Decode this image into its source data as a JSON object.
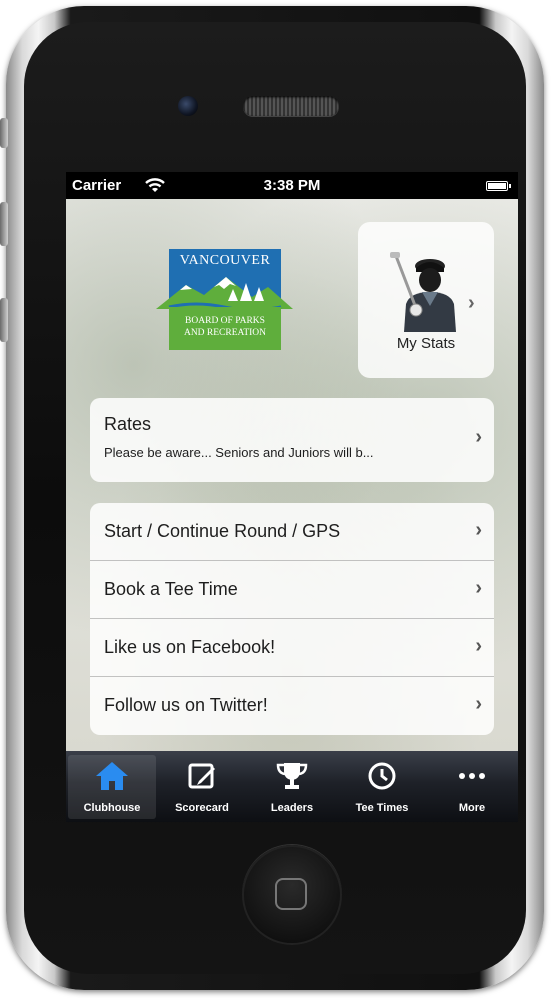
{
  "status_bar": {
    "carrier": "Carrier",
    "time": "3:38 PM"
  },
  "logo": {
    "title": "VANCOUVER",
    "line1": "BOARD OF PARKS",
    "line2": "AND RECREATION"
  },
  "stats": {
    "label": "My Stats",
    "icon": "golfer-icon"
  },
  "rates": {
    "title": "Rates",
    "message": "Please be aware... Seniors and Juniors will b..."
  },
  "menu": {
    "items": [
      {
        "label": "Start / Continue Round / GPS"
      },
      {
        "label": "Book a Tee Time"
      },
      {
        "label": "Like us on Facebook!"
      },
      {
        "label": "Follow us on Twitter!"
      }
    ]
  },
  "tabs": {
    "items": [
      {
        "label": "Clubhouse",
        "icon": "house-icon",
        "active": true
      },
      {
        "label": "Scorecard",
        "icon": "pencil-square-icon",
        "active": false
      },
      {
        "label": "Leaders",
        "icon": "trophy-icon",
        "active": false
      },
      {
        "label": "Tee Times",
        "icon": "clock-icon",
        "active": false
      },
      {
        "label": "More",
        "icon": "ellipsis-icon",
        "active": false
      }
    ]
  },
  "colors": {
    "active_tab": "#2a8cf0",
    "logo_blue": "#1f6fb2",
    "logo_green": "#5fae3c"
  }
}
